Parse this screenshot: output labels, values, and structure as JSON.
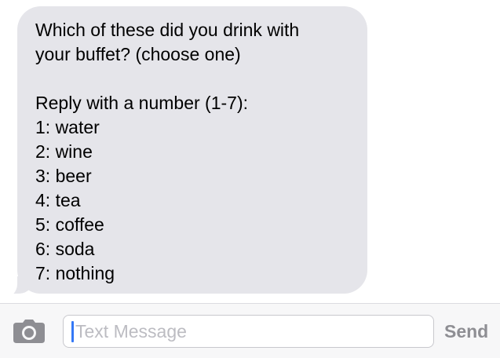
{
  "message": {
    "lines": [
      "Which of these did you drink with",
      "your buffet? (choose one)",
      "",
      "Reply with a number (1-7):",
      "1: water",
      "2: wine",
      "3: beer",
      "4: tea",
      "5: coffee",
      "6: soda",
      "7: nothing"
    ]
  },
  "composer": {
    "placeholder": "Text Message",
    "send_label": "Send",
    "camera_icon": "camera-icon"
  },
  "colors": {
    "bubble": "#e5e5ea",
    "cursor": "#3478f6",
    "send": "#8e8e93",
    "placeholder": "#bcbcc2"
  }
}
